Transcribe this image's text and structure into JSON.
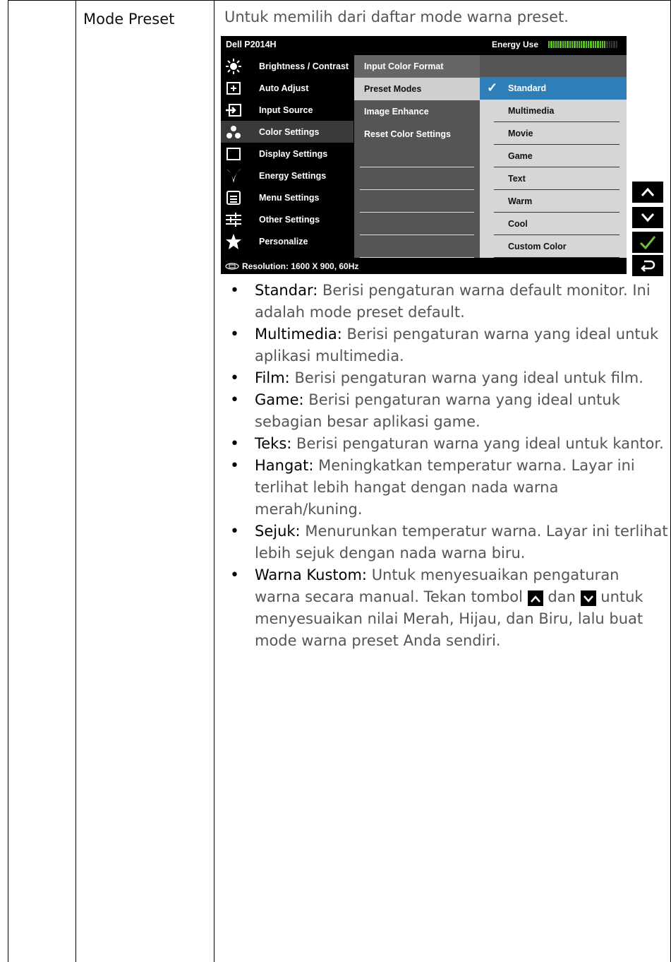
{
  "setting_name": "Mode Preset",
  "intro": "Untuk memilih dari daftar mode warna preset.",
  "osd": {
    "model": "Dell P2014H",
    "energy_label": "Energy Use",
    "energy_level": 0.82,
    "menu": [
      {
        "label": "Brightness / Contrast",
        "icon": "sun-icon"
      },
      {
        "label": "Auto Adjust",
        "icon": "auto-adjust-icon"
      },
      {
        "label": "Input Source",
        "icon": "input-source-icon"
      },
      {
        "label": "Color Settings",
        "icon": "color-dots-icon",
        "active": true
      },
      {
        "label": "Display Settings",
        "icon": "display-square-icon"
      },
      {
        "label": "Energy Settings",
        "icon": "energy-leaf-icon"
      },
      {
        "label": "Menu Settings",
        "icon": "menu-list-icon"
      },
      {
        "label": "Other Settings",
        "icon": "sliders-icon"
      },
      {
        "label": "Personalize",
        "icon": "star-icon"
      }
    ],
    "submenu": [
      "Input Color Format",
      "Preset Modes",
      "Image Enhance",
      "Reset Color Settings"
    ],
    "options": [
      "Standard",
      "Multimedia",
      "Movie",
      "Game",
      "Text",
      "Warm",
      "Cool",
      "Custom Color"
    ],
    "selected_option": "Standard",
    "resolution": "Resolution: 1600 X 900, 60Hz",
    "side_buttons": [
      "up-arrow-icon",
      "down-arrow-icon",
      "check-icon",
      "back-icon"
    ]
  },
  "bullets": [
    {
      "term": "Standar:",
      "desc": "Berisi pengaturan warna default monitor. Ini adalah mode preset default."
    },
    {
      "term": "Multimedia:",
      "desc": "Berisi pengaturan warna yang ideal untuk aplikasi multimedia."
    },
    {
      "term": "Film:",
      "desc": "Berisi pengaturan warna yang ideal untuk film."
    },
    {
      "term": "Game:",
      "desc": "Berisi pengaturan warna yang ideal untuk sebagian besar aplikasi game."
    },
    {
      "term": "Teks:",
      "desc": "Berisi pengaturan warna yang ideal untuk kantor."
    },
    {
      "term": "Hangat:",
      "desc": "Meningkatkan temperatur warna. Layar ini terlihat lebih hangat dengan nada warna merah/kuning."
    },
    {
      "term": "Sejuk:",
      "desc": "Menurunkan temperatur warna. Layar ini terlihat lebih sejuk dengan nada warna biru."
    }
  ],
  "custom": {
    "term": "Warna Kustom:",
    "desc_a": "Untuk menyesuaikan pengaturan warna secara manual. Tekan tombol",
    "desc_b": "dan",
    "desc_c": "untuk menyesuaikan nilai Merah, Hijau, dan Biru, lalu buat mode warna preset Anda sendiri."
  },
  "colors": {
    "accent": "#2e7fb8",
    "osd_bg": "#000000",
    "submenu_bg": "#555555",
    "options_bg": "#d6d6d6",
    "energy_green": "#5cc02a"
  }
}
